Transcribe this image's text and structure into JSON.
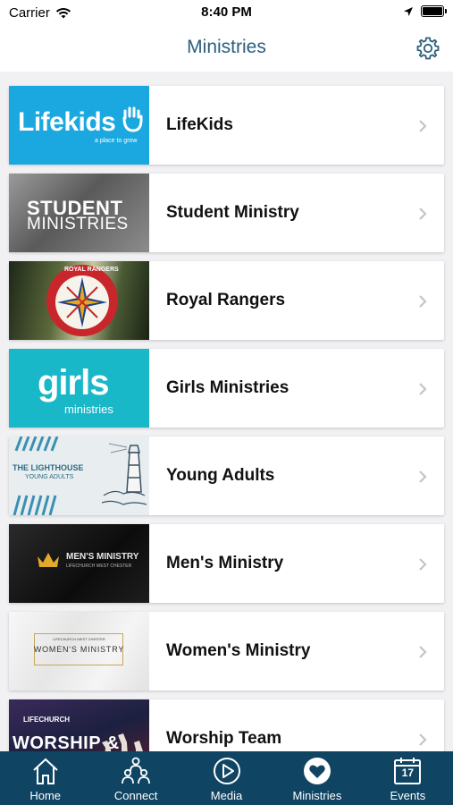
{
  "status_bar": {
    "carrier": "Carrier",
    "time": "8:40 PM"
  },
  "nav": {
    "title": "Ministries"
  },
  "ministries": [
    {
      "label": "LifeKids",
      "thumb_text": "Lifekids",
      "thumb_sub": "a place to grow",
      "bg": "#1ba8e0"
    },
    {
      "label": "Student Ministry",
      "thumb_text": "STUDENT",
      "thumb_sub": "MINISTRIES",
      "bg": "#6b6b6b"
    },
    {
      "label": "Royal Rangers",
      "thumb_text": "ROYAL RANGERS",
      "bg": "#3d4a2f"
    },
    {
      "label": "Girls Ministries",
      "thumb_text": "girls",
      "thumb_sub": "ministries",
      "bg": "#19b8c8"
    },
    {
      "label": "Young Adults",
      "thumb_text": "THE LIGHTHOUSE",
      "thumb_sub": "YOUNG ADULTS",
      "bg": "#e8eef0"
    },
    {
      "label": "Men's Ministry",
      "thumb_text": "MEN'S MINISTRY",
      "thumb_sub": "LIFECHURCH WEST CHESTER",
      "bg": "#121212"
    },
    {
      "label": "Women's Ministry",
      "thumb_text": "WOMEN'S MINISTRY",
      "thumb_sub": "LIFECHURCH WEST CHESTER",
      "bg": "#f2f2f2"
    },
    {
      "label": "Worship Team",
      "thumb_text": "WORSHIP &",
      "thumb_sub": "LIFECHURCH",
      "bg": "#23284a"
    }
  ],
  "tabs": [
    {
      "label": "Home",
      "icon": "home-icon"
    },
    {
      "label": "Connect",
      "icon": "people-icon"
    },
    {
      "label": "Media",
      "icon": "play-icon"
    },
    {
      "label": "Ministries",
      "icon": "heart-icon"
    },
    {
      "label": "Events",
      "icon": "calendar-icon",
      "badge": "17"
    }
  ],
  "colors": {
    "accent": "#2b5f7e",
    "tab_bar": "#0f4563"
  }
}
